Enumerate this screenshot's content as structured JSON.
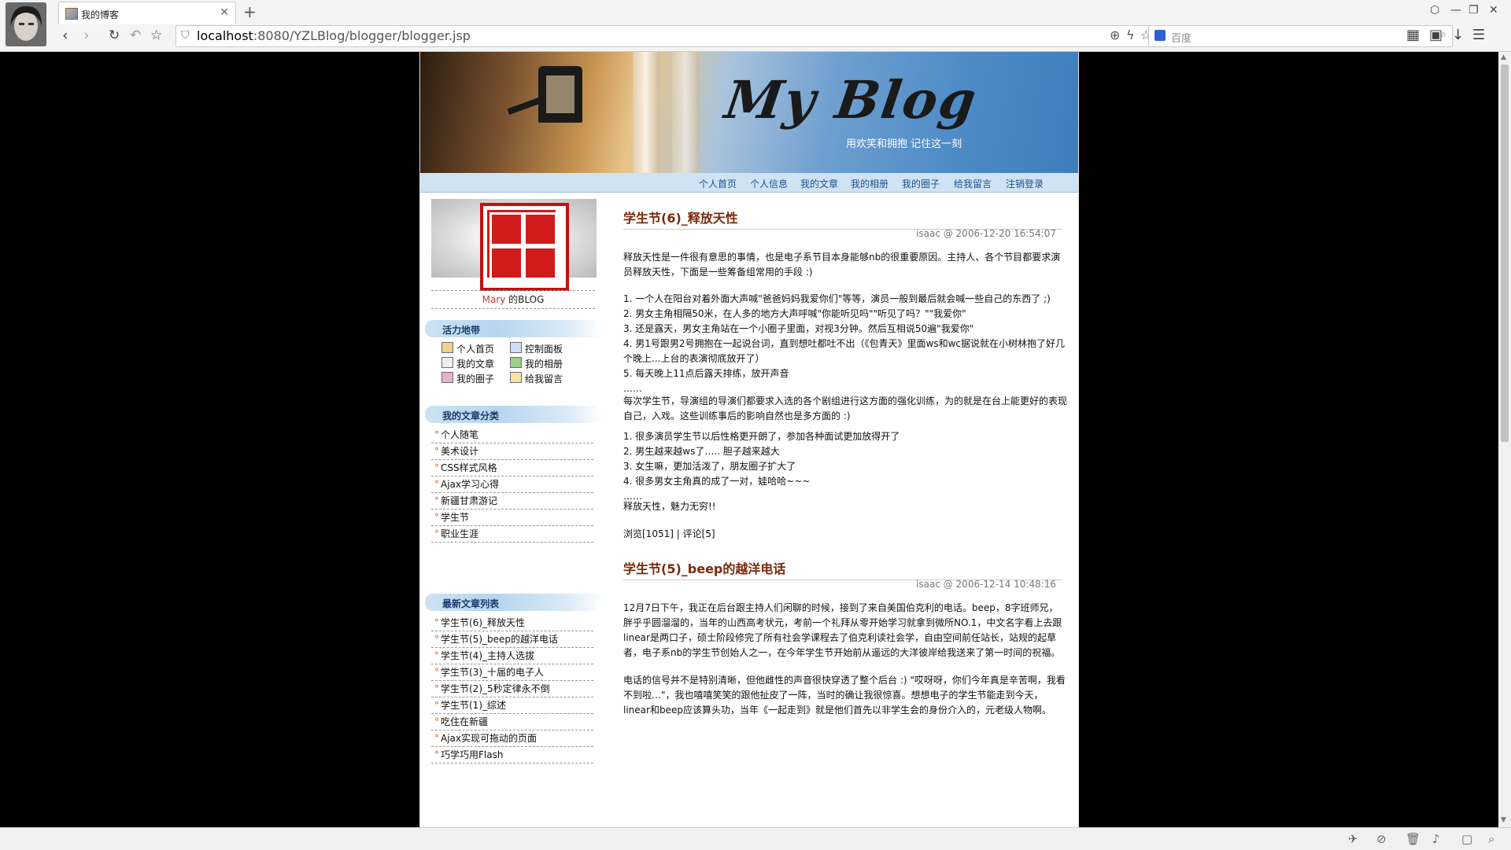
{
  "browser": {
    "tab_title": "我的博客",
    "url_host": "localhost",
    "url_rest": ":8080/YZLBlog/blogger/blogger.jsp",
    "search_placeholder": "百度"
  },
  "header": {
    "blog_title": "My Blog",
    "subtitle": "用欢笑和拥抱  记住这一刻"
  },
  "menu": [
    "个人首页",
    "个人信息",
    "我的文章",
    "我的相册",
    "我的圈子",
    "给我留言",
    "注销登录"
  ],
  "owner": {
    "name": "Mary",
    "suffix": " 的BLOG"
  },
  "hotspot": {
    "title": "活力地带",
    "items": [
      "个人首页",
      "控制面板",
      "我的文章",
      "我的相册",
      "我的圈子",
      "给我留言"
    ]
  },
  "categories": {
    "title": "我的文章分类",
    "items": [
      "个人随笔",
      "美术设计",
      "CSS样式风格",
      "Ajax学习心得",
      "新疆甘肃游记",
      "学生节",
      "职业生涯"
    ]
  },
  "recent": {
    "title": "最新文章列表",
    "items": [
      "学生节(6)_释放天性",
      "学生节(5)_beep的越洋电话",
      "学生节(4)_主持人选拔",
      "学生节(3)_十届的电子人",
      "学生节(2)_5秒定律永不倒",
      "学生节(1)_综述",
      "吃住在新疆",
      "Ajax实现可拖动的页面",
      "巧学巧用Flash"
    ]
  },
  "articles": [
    {
      "title": "学生节(6)_释放天性",
      "meta": "isaac @ 2006-12-20 16:54:07",
      "paragraphs": [
        "释放天性是一件很有意思的事情，也是电子系节目本身能够nb的很重要原因。主持人、各个节目都要求演员释放天性，下面是一些筹备组常用的手段 :)",
        "1. 一个人在阳台对着外面大声喊\"爸爸妈妈我爱你们\"等等，演员一般到最后就会喊一些自己的东西了 ;)\n2. 男女主角相隔50米，在人多的地方大声呼喊\"你能听见吗\"\"听见了吗？\"\"我爱你\"\n3. 还是露天，男女主角站在一个小圈子里面，对视3分钟。然后互相说50遍\"我爱你\"\n4. 男1号跟男2号拥抱在一起说台词，直到想吐都吐不出（《包青天》里面ws和wc据说就在小树林抱了好几个晚上...上台的表演彻底放开了）\n5. 每天晚上11点后露天排练，放开声音\n……",
        "每次学生节，导演组的导演们都要求入选的各个剧组进行这方面的强化训练，为的就是在台上能更好的表现自己，入戏。这些训练事后的影响自然也是多方面的 :)",
        "1. 很多演员学生节以后性格更开朗了，参加各种面试更加放得开了\n2. 男生越来越ws了….. 胆子越来越大\n3. 女生嘛，更加活泼了，朋友圈子扩大了\n4. 很多男女主角真的成了一对，娃哈哈~~~\n……",
        "释放天性，魅力无穷!!"
      ],
      "views": "浏览[1051]",
      "sep": " | ",
      "comments": "评论[5]"
    },
    {
      "title": "学生节(5)_beep的越洋电话",
      "meta": "isaac @ 2006-12-14 10:48:16",
      "paragraphs": [
        "12月7日下午，我正在后台跟主持人们闲聊的时候，接到了来自美国伯克利的电话。beep，8字班师兄，胖乎乎圆溜溜的，当年的山西高考状元，考前一个礼拜从零开始学习就拿到微所NO.1，中文名字看上去跟linear是两口子，硕士阶段修完了所有社会学课程去了伯克利读社会学，自由空间前任站长，站规的起草者，电子系nb的学生节创始人之一，在今年学生节开始前从遥远的大洋彼岸给我送来了第一时间的祝福。",
        "电话的信号并不是特别清晰，但他雌性的声音很快穿透了整个后台 :) \"哎呀呀，你们今年真是辛苦啊，我看不到啦…\"，我也嘻嘻笑笑的跟他扯皮了一阵，当时的确让我很惊喜。想想电子的学生节能走到今天，linear和beep应该算头功，当年《一起走到》就是他们首先以非学生会的身份介入的，元老级人物啊。"
      ]
    }
  ]
}
